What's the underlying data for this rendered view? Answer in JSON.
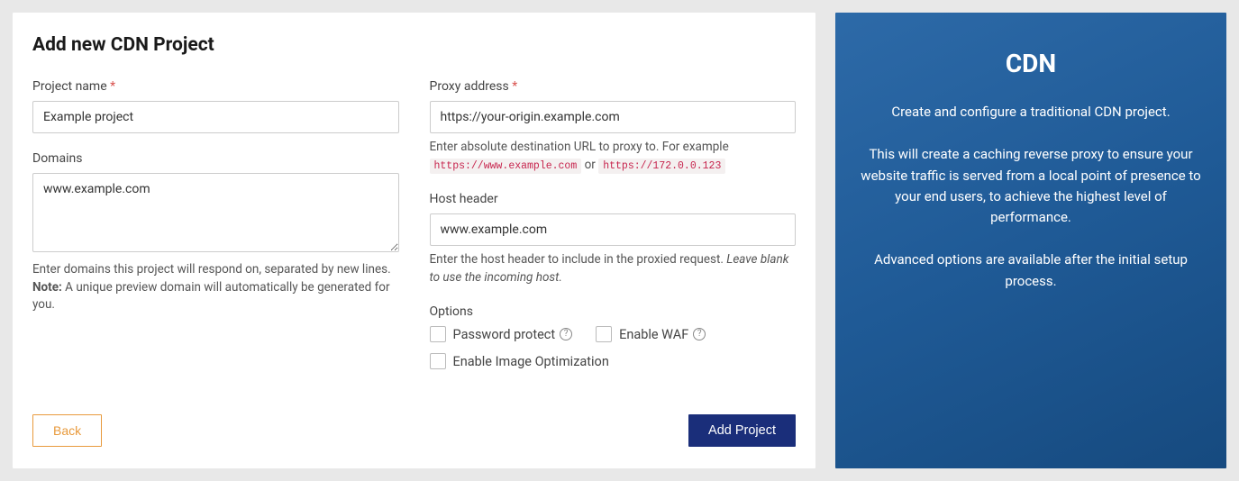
{
  "form": {
    "title": "Add new CDN Project",
    "project_name": {
      "label": "Project name",
      "value": "Example project"
    },
    "domains": {
      "label": "Domains",
      "value": "www.example.com",
      "help1": "Enter domains this project will respond on, separated by new lines.",
      "note_label": "Note:",
      "note_text": " A unique preview domain will automatically be generated for you."
    },
    "proxy": {
      "label": "Proxy address",
      "value": "https://your-origin.example.com",
      "help_prefix": "Enter absolute destination URL to proxy to. For example ",
      "example1": "https://www.example.com",
      "or_text": " or ",
      "example2": "https://172.0.0.123"
    },
    "host_header": {
      "label": "Host header",
      "value": "www.example.com",
      "help_prefix": "Enter the host header to include in the proxied request. ",
      "help_italic": "Leave blank to use the incoming host."
    },
    "options": {
      "label": "Options",
      "password_protect": "Password protect",
      "enable_waf": "Enable WAF",
      "enable_image_opt": "Enable Image Optimization"
    },
    "buttons": {
      "back": "Back",
      "submit": "Add Project"
    }
  },
  "info": {
    "title": "CDN",
    "p1": "Create and configure a traditional CDN project.",
    "p2": "This will create a caching reverse proxy to ensure your website traffic is served from a local point of presence to your end users, to achieve the highest level of performance.",
    "p3": "Advanced options are available after the initial setup process."
  }
}
